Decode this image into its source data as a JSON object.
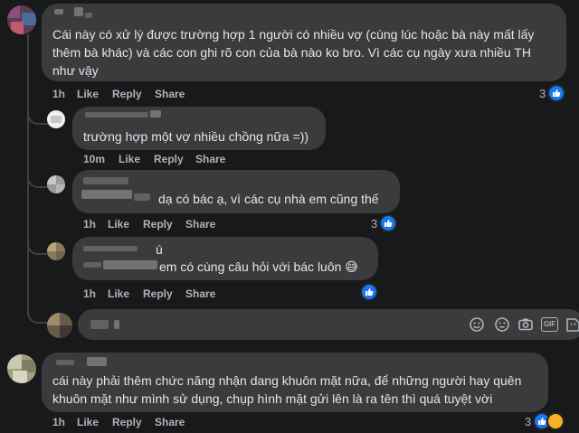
{
  "comments": [
    {
      "text_lines": [
        "Cái này có xử lý được trường hợp 1 người có nhiều vợ (cùng lúc hoặc bà này mất lấy",
        "thêm bà khác) và các con ghi rõ con của bà nào ko bro. Vì các cụ ngày xưa nhiều TH",
        "như vậy"
      ],
      "time": "1h",
      "like": "Like",
      "reply": "Reply",
      "share": "Share",
      "reactions": "3"
    },
    {
      "text_lines": [
        "trường hợp một vợ nhiều chồng nữa =))"
      ],
      "time": "10m",
      "like": "Like",
      "reply": "Reply",
      "share": "Share"
    },
    {
      "text_lines": [
        "dạ có bác ạ, vì các cụ nhà em cũng thế"
      ],
      "time": "1h",
      "like": "Like",
      "reply": "Reply",
      "share": "Share",
      "reactions": "3"
    },
    {
      "name_fragment": "ú",
      "text_lines": [
        "em có cùng câu hỏi với bác luôn 😅"
      ],
      "time": "1h",
      "like": "Like",
      "reply": "Reply",
      "share": "Share"
    },
    {
      "text_lines": [
        "cái này phải thêm chức năng nhận dang khuôn mặt nữa, để những người hay quên",
        "khuôn mặt như mình sử dụng, chụp hình mặt gửi lên là ra tên thì quá tuyệt vời"
      ],
      "time": "1h",
      "like": "Like",
      "reply": "Reply",
      "share": "Share",
      "reactions": "3"
    }
  ],
  "composer": {
    "icons": [
      "emoji-icon",
      "sticker-icon",
      "camera-icon",
      "gif-icon",
      "stickers-more-icon"
    ],
    "gif_label": "GIF"
  },
  "colors": {
    "background": "#18191a",
    "bubble": "#3a3b3c",
    "text": "#e4e6eb",
    "secondary": "#b0b3b8",
    "like_blue": "#1877f2",
    "haha_yellow": "#f7b125"
  }
}
